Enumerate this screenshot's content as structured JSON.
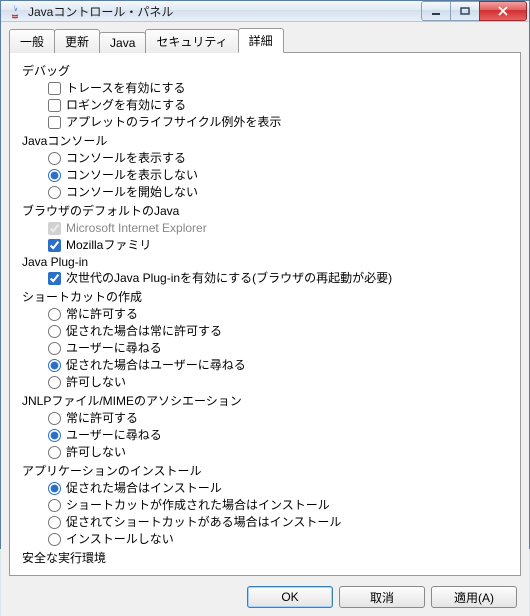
{
  "window": {
    "title": "Javaコントロール・パネル"
  },
  "tabs": [
    "一般",
    "更新",
    "Java",
    "セキュリティ",
    "詳細"
  ],
  "active_tab": 4,
  "tree": [
    {
      "type": "group",
      "label": "デバッグ"
    },
    {
      "type": "checkbox",
      "label": "トレースを有効にする",
      "checked": false
    },
    {
      "type": "checkbox",
      "label": "ロギングを有効にする",
      "checked": false
    },
    {
      "type": "checkbox",
      "label": "アプレットのライフサイクル例外を表示",
      "checked": false
    },
    {
      "type": "group",
      "label": "Javaコンソール"
    },
    {
      "type": "radio",
      "group": "console",
      "label": "コンソールを表示する",
      "checked": false
    },
    {
      "type": "radio",
      "group": "console",
      "label": "コンソールを表示しない",
      "checked": true
    },
    {
      "type": "radio",
      "group": "console",
      "label": "コンソールを開始しない",
      "checked": false
    },
    {
      "type": "group",
      "label": "ブラウザのデフォルトのJava"
    },
    {
      "type": "checkbox",
      "label": "Microsoft Internet Explorer",
      "checked": true,
      "disabled": true
    },
    {
      "type": "checkbox",
      "label": "Mozillaファミリ",
      "checked": true
    },
    {
      "type": "group",
      "label": "Java Plug-in"
    },
    {
      "type": "checkbox",
      "label": "次世代のJava Plug-inを有効にする(ブラウザの再起動が必要)",
      "checked": true
    },
    {
      "type": "group",
      "label": "ショートカットの作成"
    },
    {
      "type": "radio",
      "group": "shortcut",
      "label": "常に許可する",
      "checked": false
    },
    {
      "type": "radio",
      "group": "shortcut",
      "label": "促された場合は常に許可する",
      "checked": false
    },
    {
      "type": "radio",
      "group": "shortcut",
      "label": "ユーザーに尋ねる",
      "checked": false
    },
    {
      "type": "radio",
      "group": "shortcut",
      "label": "促された場合はユーザーに尋ねる",
      "checked": true
    },
    {
      "type": "radio",
      "group": "shortcut",
      "label": "許可しない",
      "checked": false
    },
    {
      "type": "group",
      "label": "JNLPファイル/MIMEのアソシエーション"
    },
    {
      "type": "radio",
      "group": "assoc",
      "label": "常に許可する",
      "checked": false
    },
    {
      "type": "radio",
      "group": "assoc",
      "label": "ユーザーに尋ねる",
      "checked": true
    },
    {
      "type": "radio",
      "group": "assoc",
      "label": "許可しない",
      "checked": false
    },
    {
      "type": "group",
      "label": "アプリケーションのインストール"
    },
    {
      "type": "radio",
      "group": "install",
      "label": "促された場合はインストール",
      "checked": true
    },
    {
      "type": "radio",
      "group": "install",
      "label": "ショートカットが作成された場合はインストール",
      "checked": false
    },
    {
      "type": "radio",
      "group": "install",
      "label": "促されてショートカットがある場合はインストール",
      "checked": false
    },
    {
      "type": "radio",
      "group": "install",
      "label": "インストールしない",
      "checked": false
    },
    {
      "type": "group",
      "label": "安全な実行環境"
    }
  ],
  "buttons": {
    "ok": "OK",
    "cancel": "取消",
    "apply": "適用(A)"
  }
}
